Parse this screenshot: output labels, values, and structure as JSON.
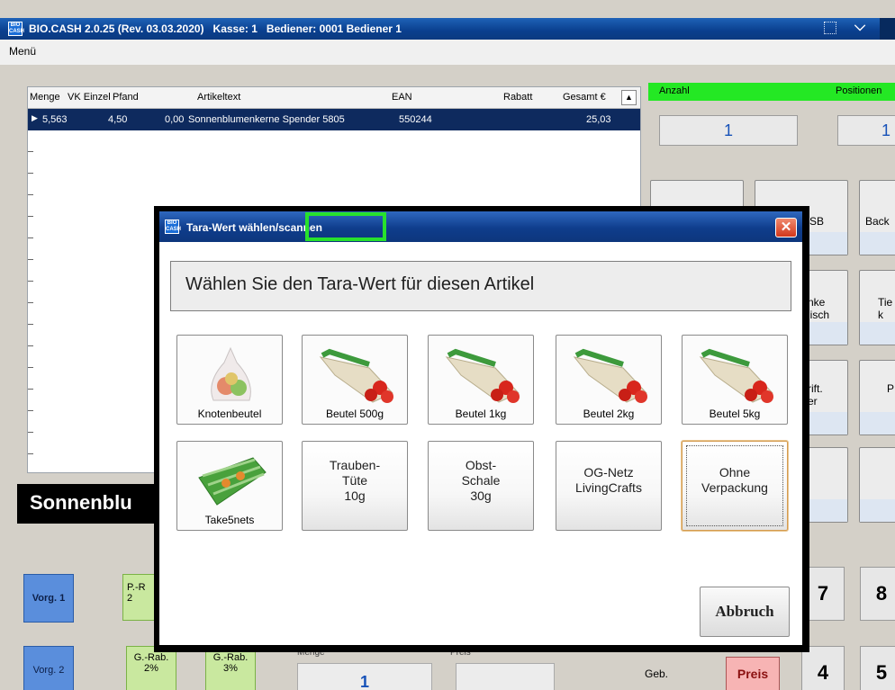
{
  "window": {
    "title": "BIO.CASH 2.0.25 (Rev. 03.03.2020)   Kasse: 1   Bediener: 0001 Bediener 1",
    "app_icon": "BIO CASH"
  },
  "menubar": {
    "menu": "Menü"
  },
  "table": {
    "headers": [
      "Menge",
      "VK Einzel",
      "Pfand",
      "Artikeltext",
      "EAN",
      "Rabatt",
      "Gesamt €"
    ],
    "rows": [
      {
        "menge": "5,563",
        "vk": "4,50",
        "pfand": "0,00",
        "artikeltext": "Sonnenblumenkerne Spender 5805",
        "ean": "550244",
        "rabatt": "",
        "gesamt": "25,03"
      }
    ]
  },
  "right_panel": {
    "anzahl_label": "Anzahl",
    "positionen_label": "Positionen",
    "anzahl_value": "1",
    "positionen_value": "1",
    "buttons": [
      "SB",
      "Back",
      "nke\nlisch",
      "Tie\nk",
      "rift.\ner",
      "P"
    ]
  },
  "product_name": "Sonnenblu",
  "bottom": {
    "vorg1": "Vorg. 1",
    "vorg2": "Vorg. 2",
    "p_rab": "P.-R\n2",
    "g_rab_2": "G.-Rab.\n2%",
    "g_rab_3": "G.-Rab.\n3%",
    "menge_label": "Menge",
    "preis_label": "Preis",
    "menge_value": "1",
    "geb": "Geb.",
    "preis_button": "Preis",
    "keys": [
      "7",
      "8",
      "4",
      "5"
    ]
  },
  "dialog": {
    "title": "Tara-Wert wählen/scannen",
    "prompt": "Wählen Sie den Tara-Wert für diesen Artikel",
    "tiles_row1": [
      "Knotenbeutel",
      "Beutel 500g",
      "Beutel 1kg",
      "Beutel 2kg",
      "Beutel 5kg"
    ],
    "tiles_row2_img": "Take5nets",
    "tiles_row2_text": [
      "Trauben-\nTüte\n10g",
      "Obst-\nSchale\n30g",
      "OG-Netz\nLivingCrafts",
      "Ohne\nVerpackung"
    ],
    "cancel": "Abbruch"
  },
  "colors": {
    "titlebar": "#0a3f8e",
    "selection_row": "#0e2a5e",
    "highlight_box": "#27e12c",
    "green_header": "#24e824",
    "close_button": "#d2381c"
  }
}
